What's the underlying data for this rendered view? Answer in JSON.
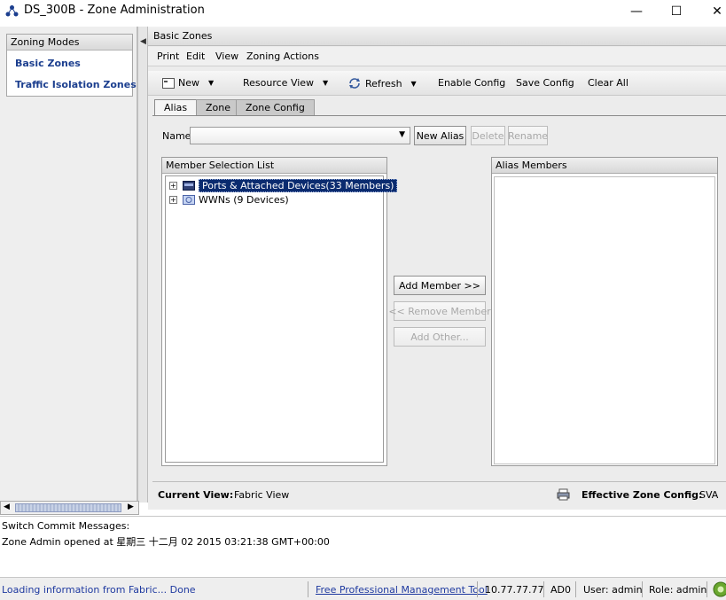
{
  "window": {
    "title": "DS_300B - Zone Administration",
    "minimize": "—",
    "maximize": "☐",
    "close": "✕"
  },
  "left": {
    "header": "Zoning Modes",
    "items": [
      "Basic Zones",
      "Traffic Isolation Zones"
    ]
  },
  "main": {
    "header": "Basic Zones",
    "menus": [
      "Print",
      "Edit",
      "View",
      "Zoning Actions"
    ],
    "toolbar": {
      "new": "New",
      "resource_view": "Resource View",
      "refresh": "Refresh",
      "enable_config": "Enable Config",
      "save_config": "Save Config",
      "clear_all": "Clear All"
    },
    "tabs": [
      "Alias",
      "Zone",
      "Zone Config"
    ],
    "name_label": "Name",
    "name_value": "",
    "buttons": {
      "new_alias": "New Alias",
      "delete": "Delete",
      "rename": "Rename",
      "add_member": "Add Member >>",
      "remove_member": "<< Remove Member",
      "add_other": "Add Other..."
    },
    "member_list": {
      "header": "Member Selection List",
      "nodes": [
        {
          "label": "Ports & Attached Devices(33 Members)",
          "selected": true
        },
        {
          "label": "WWNs (9 Devices)",
          "selected": false
        }
      ]
    },
    "alias_members": {
      "header": "Alias Members"
    },
    "current_view_label": "Current View:",
    "current_view_value": "Fabric View",
    "effective_label": "Effective Zone Config:",
    "effective_value": "SVA"
  },
  "messages": {
    "title": "Switch Commit Messages:",
    "lines": [
      "Zone Admin opened at 星期三 十二月 02 2015 03:21:38 GMT+00:00"
    ]
  },
  "status": {
    "loading": "Loading information from Fabric... Done",
    "link": "Free Professional Management Tool",
    "ip": "10.77.77.77",
    "ad": "AD0",
    "user": "User: admin",
    "role": "Role: admin"
  },
  "colors": {
    "link_blue": "#1c3f8f",
    "selected_bg": "#0a2b6f"
  }
}
